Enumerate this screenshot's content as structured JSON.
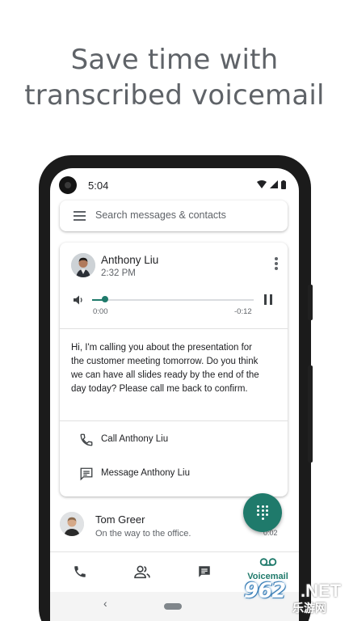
{
  "headline": {
    "line1": "Save time with",
    "line2": "transcribed voicemail"
  },
  "status_bar": {
    "time": "5:04",
    "icons": [
      "wifi-icon",
      "signal-icon",
      "battery-icon"
    ]
  },
  "search": {
    "placeholder": "Search messages & contacts"
  },
  "voicemail_card": {
    "caller_name": "Anthony Liu",
    "call_time": "2:32 PM",
    "player": {
      "elapsed": "0:00",
      "remaining": "-0:12",
      "progress": 0.08
    },
    "transcript_lines": [
      "Hi, I'm calling you about the presentation for",
      "the customer meeting tomorrow. Do you think",
      "we can have all slides ready by the end of the",
      "day today? Please call me back to confirm."
    ],
    "actions": {
      "call": "Call Anthony Liu",
      "message": "Message Anthony Liu"
    }
  },
  "conversation": {
    "name": "Tom Greer",
    "snippet": "On the way to the office.",
    "time": "0:02"
  },
  "bottom_nav": {
    "items": [
      {
        "icon": "phone-icon",
        "label": ""
      },
      {
        "icon": "contacts-icon",
        "label": ""
      },
      {
        "icon": "message-icon",
        "label": ""
      },
      {
        "icon": "voicemail-icon",
        "label": "Voicemail"
      }
    ],
    "active_index": 3
  },
  "system_nav": {
    "back": "‹"
  },
  "watermark": {
    "number": "962",
    "suffix": ".NET",
    "chinese": "乐游网"
  },
  "colors": {
    "accent": "#1f7a6b",
    "headline": "#5f6368",
    "text_primary": "#202124",
    "text_secondary": "#5f6368"
  }
}
